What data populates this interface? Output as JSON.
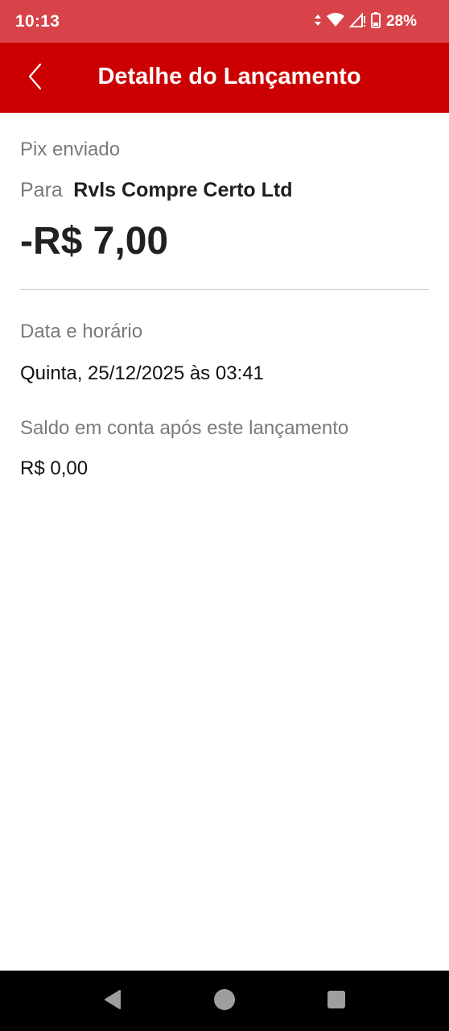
{
  "status_bar": {
    "time": "10:13",
    "battery_percent": "28%",
    "icons": [
      "data-arrows-icon",
      "wifi-icon",
      "signal-icon",
      "battery-icon"
    ]
  },
  "app_bar": {
    "title": "Detalhe do Lançamento",
    "back_icon": "chevron-left-icon",
    "background_color": "#cc0000"
  },
  "transaction": {
    "type": "Pix enviado",
    "recipient_label": "Para",
    "recipient_name": "Rvls Compre Certo Ltd",
    "amount": "-R$ 7,00"
  },
  "details": [
    {
      "label": "Data e horário",
      "value": "Quinta, 25/12/2025 às 03:41"
    },
    {
      "label": "Saldo em conta após este lançamento",
      "value": "R$ 0,00"
    }
  ],
  "nav_bar": {
    "buttons": [
      "back-triangle-icon",
      "home-circle-icon",
      "recents-square-icon"
    ]
  }
}
